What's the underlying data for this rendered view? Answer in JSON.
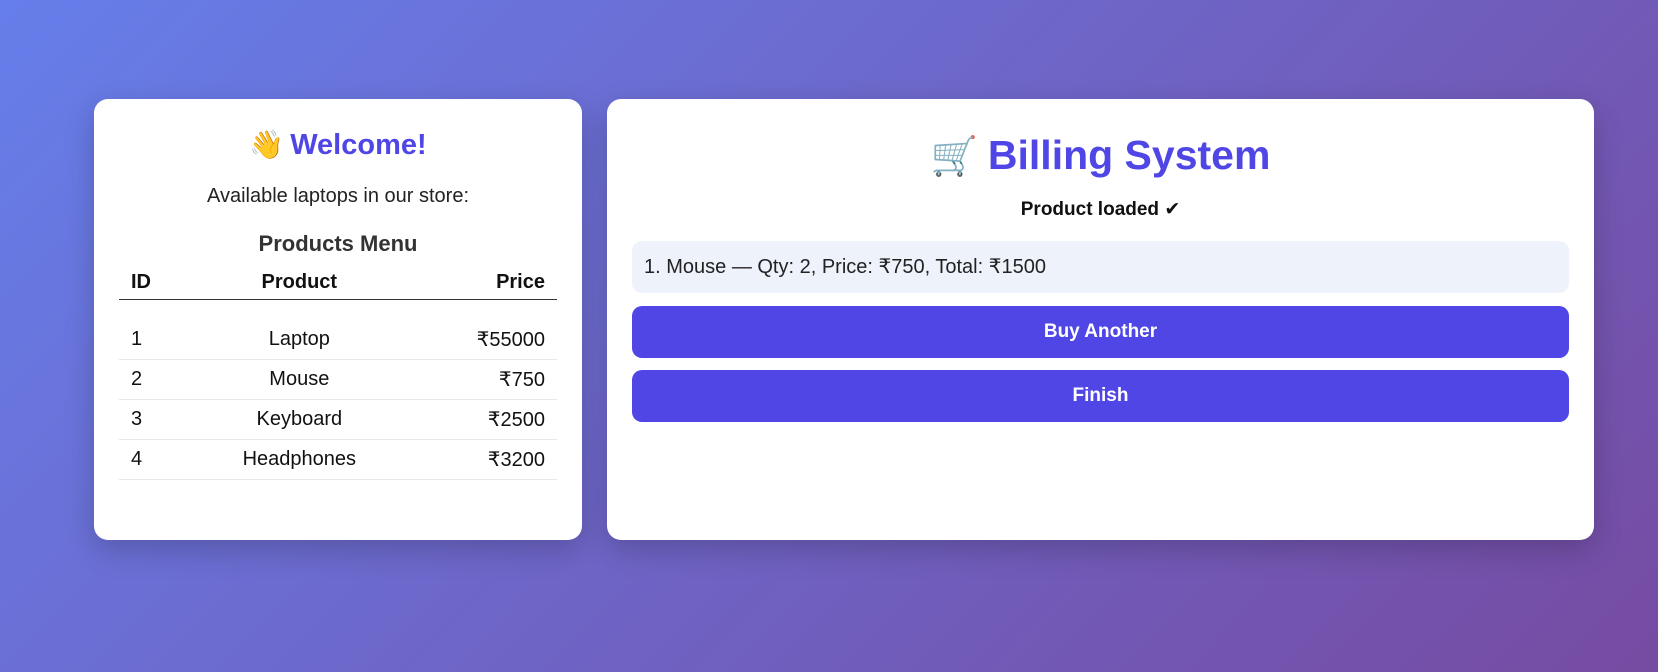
{
  "welcome": {
    "emoji": "👋",
    "title": "Welcome!",
    "subtitle": "Available laptops in our store:"
  },
  "menu": {
    "title": "Products Menu",
    "columns": [
      "ID",
      "Product",
      "Price"
    ],
    "rows": [
      {
        "id": "1",
        "product": "Laptop",
        "price": "₹55000"
      },
      {
        "id": "2",
        "product": "Mouse",
        "price": "₹750"
      },
      {
        "id": "3",
        "product": "Keyboard",
        "price": "₹2500"
      },
      {
        "id": "4",
        "product": "Headphones",
        "price": "₹3200"
      }
    ]
  },
  "billing": {
    "emoji": "🛒",
    "title": "Billing System",
    "status": "Product loaded ✔",
    "items": [
      "1. Mouse — Qty: 2, Price: ₹750, Total: ₹1500"
    ],
    "buy_another_label": "Buy Another",
    "finish_label": "Finish"
  },
  "colors": {
    "accent": "#4f46e5",
    "background_start": "#667eea",
    "background_end": "#764ba2",
    "bill_line_bg": "#eef2fb"
  }
}
